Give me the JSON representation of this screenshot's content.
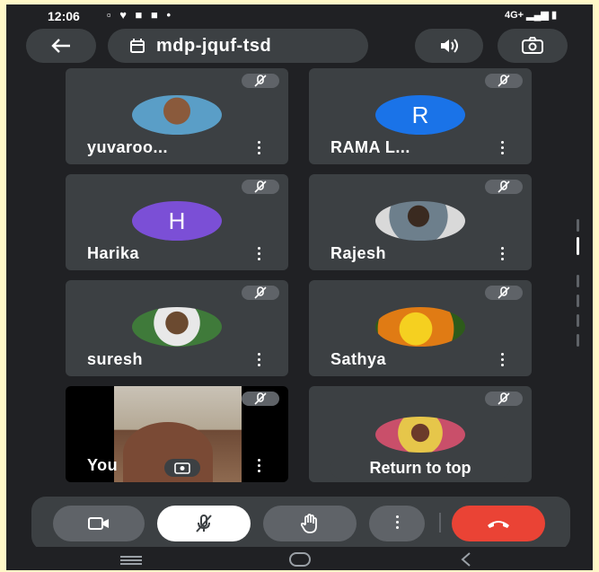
{
  "status_bar": {
    "time": "12:06",
    "right_text": "4G+"
  },
  "header": {
    "meeting_code": "mdp-jquf-tsd"
  },
  "participants": [
    {
      "name": "yuvaroo...",
      "avatar": "photo"
    },
    {
      "name": "RAMA L...",
      "avatar_letter": "R",
      "avatar_color": "#1a73e8"
    },
    {
      "name": "Harika",
      "avatar_letter": "H",
      "avatar_color": "#7b4fd6"
    },
    {
      "name": "Rajesh",
      "avatar": "photo"
    },
    {
      "name": "suresh",
      "avatar": "photo"
    },
    {
      "name": "Sathya",
      "avatar": "photo"
    },
    {
      "name": "You",
      "avatar": "self-video"
    },
    {
      "name": "",
      "avatar": "photo"
    }
  ],
  "overlay": {
    "return_to_top": "Return to top"
  },
  "controls": {
    "end_call_color": "#ea4335"
  }
}
